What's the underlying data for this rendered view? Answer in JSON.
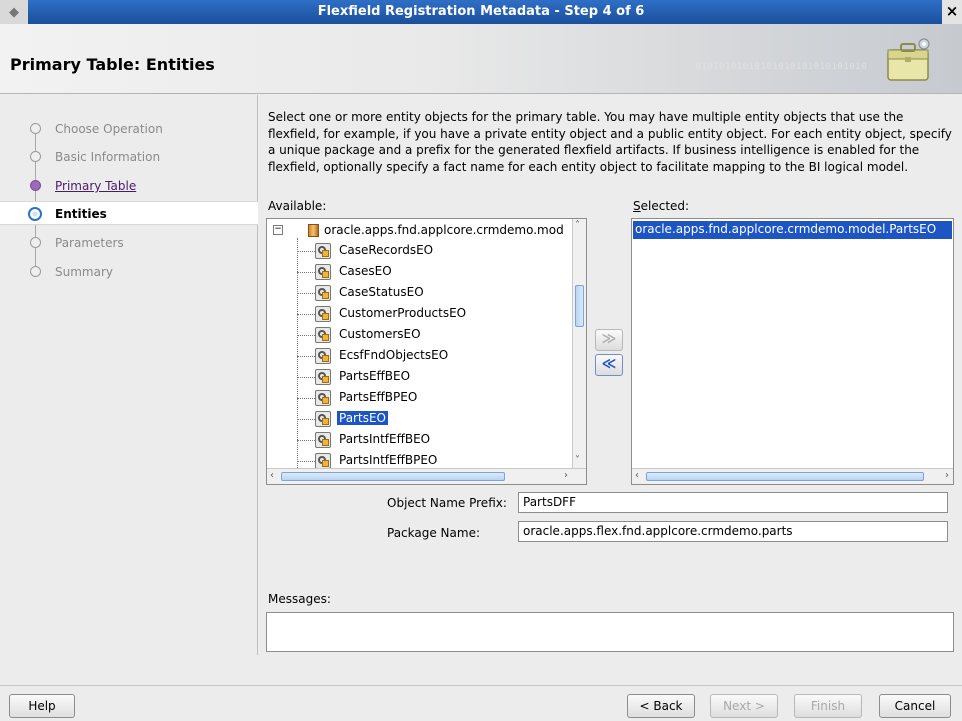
{
  "window": {
    "title": "Flexfield Registration Metadata - Step 4 of 6",
    "close_glyph": "×"
  },
  "header": {
    "heading": "Primary Table: Entities",
    "decoration_text": "01010101010101010101010101010",
    "icon": "briefcase-icon"
  },
  "steps": [
    {
      "label": "Choose Operation",
      "state": "inactive"
    },
    {
      "label": "Basic Information",
      "state": "inactive"
    },
    {
      "label": "Primary Table",
      "state": "visited"
    },
    {
      "label": "Entities",
      "state": "current"
    },
    {
      "label": "Parameters",
      "state": "inactive"
    },
    {
      "label": "Summary",
      "state": "inactive"
    }
  ],
  "description": "Select one or more entity objects for the primary table. You may have multiple entity objects that use the flexfield, for example, if you have a private entity object and a public entity object. For each entity object, specify a unique package and a prefix for the generated flexfield artifacts. If business intelligence is enabled for the flexfield, optionally specify a fact name for each entity object to facilitate mapping to the BI logical model.",
  "available": {
    "label": "Available:",
    "root": "oracle.apps.fnd.applcore.crmdemo.mod",
    "items": [
      "CaseRecordsEO",
      "CasesEO",
      "CaseStatusEO",
      "CustomerProductsEO",
      "CustomersEO",
      "EcsfFndObjectsEO",
      "PartsEffBEO",
      "PartsEffBPEO",
      "PartsEO",
      "PartsIntfEffBEO",
      "PartsIntfEffBPEO"
    ],
    "selected_item": "PartsEO"
  },
  "selected": {
    "label": "Selected:",
    "items": [
      "oracle.apps.fnd.applcore.crmdemo.model.PartsEO"
    ]
  },
  "shuttle": {
    "add_label": "≫",
    "remove_label": "≪"
  },
  "form": {
    "prefix_label": "Object Name Prefix:",
    "prefix_value": "PartsDFF",
    "package_label": "Package Name:",
    "package_value": "oracle.apps.flex.fnd.applcore.crmdemo.parts"
  },
  "messages": {
    "label": "Messages:"
  },
  "buttons": {
    "help": "Help",
    "back": "< Back",
    "next": "Next >",
    "finish": "Finish",
    "cancel": "Cancel"
  }
}
